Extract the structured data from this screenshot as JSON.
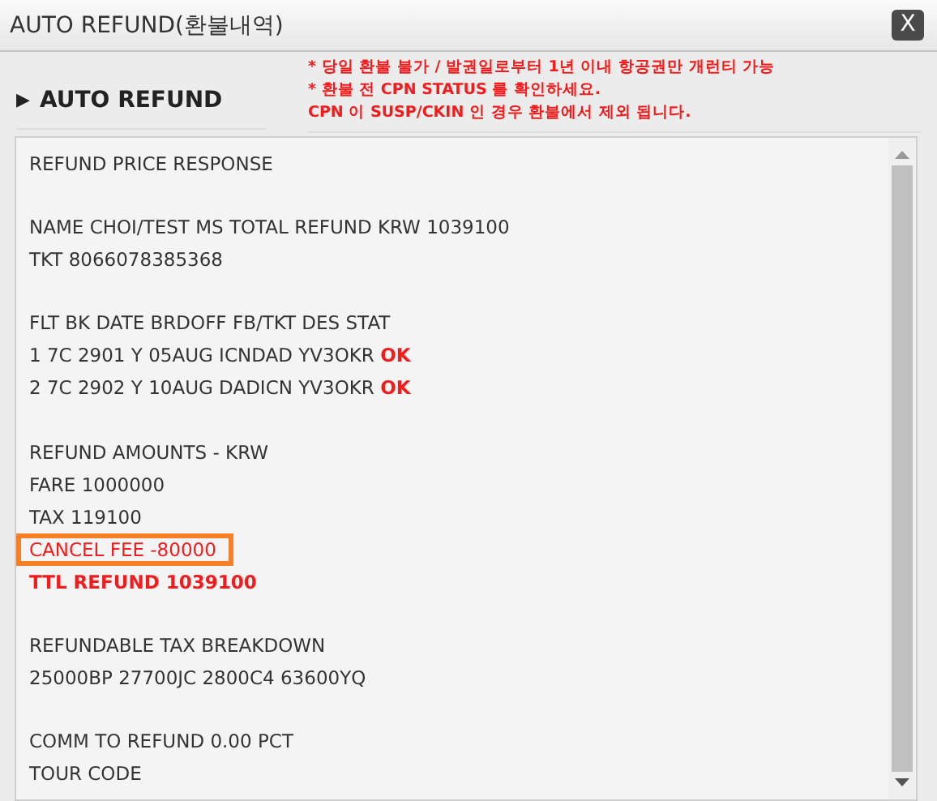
{
  "window": {
    "title": "AUTO REFUND(환불내역)",
    "close": "X"
  },
  "section": {
    "marker": "▶",
    "title": "AUTO REFUND"
  },
  "notices": [
    "* 당일 환불 불가 / 발권일로부터 1년 이내 항공권만 개런티 가능",
    "* 환불 전 CPN STATUS 를 확인하세요.",
    "CPN 이 SUSP/CKIN 인 경우 환불에서 제외 됩니다."
  ],
  "response_lines": [
    {
      "kind": "text",
      "text": "REFUND PRICE RESPONSE"
    },
    {
      "kind": "blank"
    },
    {
      "kind": "text",
      "text": "NAME CHOI/TEST MS TOTAL REFUND KRW 1039100"
    },
    {
      "kind": "text",
      "text": "TKT 8066078385368"
    },
    {
      "kind": "blank"
    },
    {
      "kind": "text",
      "text": "FLT BK DATE BRDOFF FB/TKT DES STAT"
    },
    {
      "kind": "status",
      "text": "1 7C 2901 Y 05AUG ICNDAD YV3OKR",
      "status": "OK"
    },
    {
      "kind": "status",
      "text": "2 7C 2902 Y 10AUG DADICN YV3OKR",
      "status": "OK"
    },
    {
      "kind": "blank"
    },
    {
      "kind": "text",
      "text": "REFUND AMOUNTS - KRW"
    },
    {
      "kind": "text",
      "text": "FARE 1000000"
    },
    {
      "kind": "text",
      "text": "TAX 119100"
    },
    {
      "kind": "highlight",
      "text": "CANCEL FEE -80000"
    },
    {
      "kind": "total",
      "text": "TTL REFUND 1039100"
    },
    {
      "kind": "blank"
    },
    {
      "kind": "text",
      "text": "REFUNDABLE TAX BREAKDOWN"
    },
    {
      "kind": "text",
      "text": "25000BP 27700JC 2800C4 63600YQ"
    },
    {
      "kind": "blank"
    },
    {
      "kind": "text",
      "text": "COMM TO REFUND 0.00 PCT"
    },
    {
      "kind": "text",
      "text": "TOUR CODE"
    }
  ]
}
